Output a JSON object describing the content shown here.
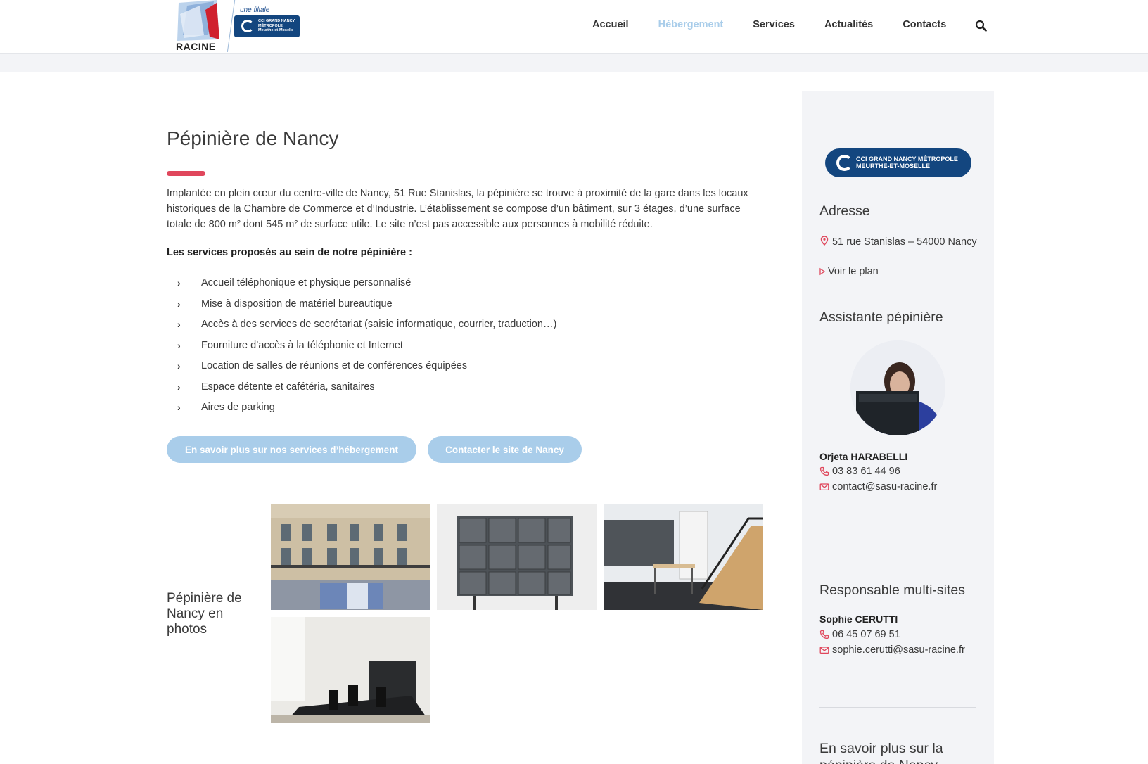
{
  "header": {
    "logo_text": "RACINE",
    "filiale_label": "une filiale",
    "cci_small_text": "CCI GRAND NANCY MÉTROPOLE Meurthe-et-Moselle",
    "nav": [
      {
        "label": "Accueil",
        "active": false
      },
      {
        "label": "Hébergement",
        "active": true
      },
      {
        "label": "Services",
        "active": false
      },
      {
        "label": "Actualités",
        "active": false
      },
      {
        "label": "Contacts",
        "active": false
      }
    ],
    "search_icon": "search-icon"
  },
  "main": {
    "title": "Pépinière de Nancy",
    "intro": "Implantée en plein cœur du centre-ville de Nancy, 51 Rue Stanislas, la pépinière se trouve à proximité de la gare dans les locaux historiques de la Chambre de Commerce et d’Industrie. L’établissement se compose d’un bâtiment, sur 3 étages, d’une surface totale de 800 m² dont 545 m² de surface utile. Le site n’est pas accessible aux personnes à mobilité réduite.",
    "services_heading": "Les services proposés au sein de notre pépinière :",
    "services": [
      "Accueil téléphonique et physique personnalisé",
      "Mise à disposition de matériel bureautique",
      "Accès à des services de secrétariat (saisie informatique, courrier, traduction…)",
      "Fourniture d’accès à la téléphonie et Internet",
      "Location de salles de réunions et de conférences équipées",
      "Espace détente et cafétéria, sanitaires",
      "Aires de parking"
    ],
    "buttons": {
      "more_services": "En savoir plus sur nos services d’hébergement",
      "contact_site": "Contacter le site de Nancy"
    },
    "photos_title": "Pépinière de Nancy en photos"
  },
  "sidebar": {
    "cci_badge": {
      "line1": "CCI GRAND NANCY MÉTROPOLE",
      "line2": "MEURTHE-ET-MOSELLE"
    },
    "address_heading": "Adresse",
    "address": "51 rue Stanislas – 54000 Nancy",
    "map_link": "Voir le plan",
    "assistant_heading": "Assistante pépinière",
    "assistant_name": "Orjeta HARABELLI",
    "assistant_phone": "03 83 61 44 96",
    "assistant_email": "contact@sasu-racine.fr",
    "manager_heading": "Responsable multi-sites",
    "manager_name": "Sophie CERUTTI",
    "manager_phone": "06 45 07 69 51",
    "manager_email": "sophie.cerutti@sasu-racine.fr",
    "more_heading": "En savoir plus sur la pépinière de Nancy"
  },
  "colors": {
    "accent_red": "#e0475c",
    "button_blue": "#a9cdea",
    "cci_navy": "#13467f",
    "sidebar_bg": "#f3f4f7"
  }
}
